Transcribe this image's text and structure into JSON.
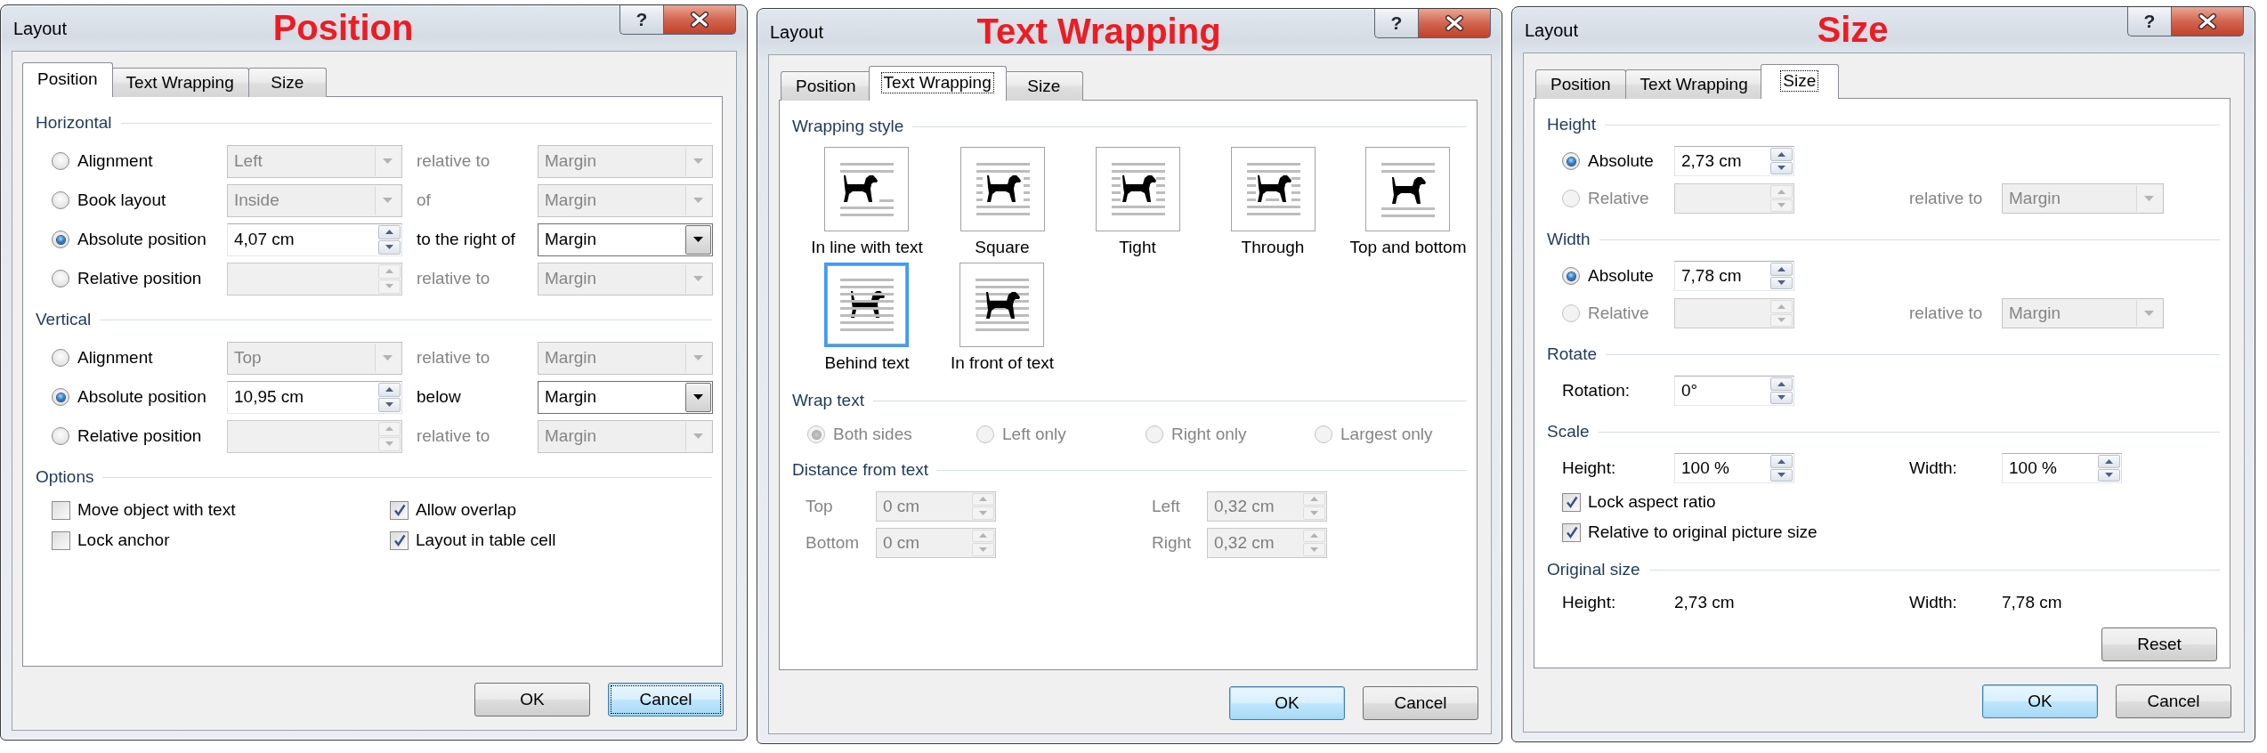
{
  "dialogs": [
    {
      "title": "Layout",
      "annotation": "Position",
      "help": "?",
      "tabs": [
        {
          "label": "Position",
          "selected": true,
          "focused": false
        },
        {
          "label": "Text Wrapping",
          "selected": false,
          "focused": false
        },
        {
          "label": "Size",
          "selected": false,
          "focused": false
        }
      ],
      "sections": [
        {
          "kind": "placement",
          "heading": "Horizontal",
          "rows": [
            [
              {
                "kind": "radio",
                "label": "Alignment",
                "selected": false,
                "disabled": false
              },
              {
                "kind": "dropdown",
                "value": "Left",
                "disabled": true
              },
              {
                "kind": "label",
                "text": "relative to",
                "disabled": true
              },
              {
                "kind": "dropdown",
                "value": "Margin",
                "disabled": true
              }
            ],
            [
              {
                "kind": "radio",
                "label": "Book layout",
                "selected": false,
                "disabled": false
              },
              {
                "kind": "dropdown",
                "value": "Inside",
                "disabled": true
              },
              {
                "kind": "label",
                "text": "of",
                "disabled": true
              },
              {
                "kind": "dropdown",
                "value": "Margin",
                "disabled": true
              }
            ],
            [
              {
                "kind": "radio",
                "label": "Absolute position",
                "selected": true,
                "disabled": false
              },
              {
                "kind": "spin",
                "value": "4,07 cm",
                "disabled": false
              },
              {
                "kind": "label",
                "text": "to the right of",
                "disabled": false
              },
              {
                "kind": "dropdown",
                "value": "Margin",
                "disabled": false
              }
            ],
            [
              {
                "kind": "radio",
                "label": "Relative position",
                "selected": false,
                "disabled": false
              },
              {
                "kind": "spin",
                "disabled": true
              },
              {
                "kind": "label",
                "text": "relative to",
                "disabled": true
              },
              {
                "kind": "dropdown",
                "value": "Margin",
                "disabled": true
              }
            ]
          ]
        },
        {
          "kind": "placement",
          "heading": "Vertical",
          "rows": [
            [
              {
                "kind": "radio",
                "label": "Alignment",
                "selected": false,
                "disabled": false
              },
              {
                "kind": "dropdown",
                "value": "Top",
                "disabled": true
              },
              {
                "kind": "label",
                "text": "relative to",
                "disabled": true
              },
              {
                "kind": "dropdown",
                "value": "Margin",
                "disabled": true
              }
            ],
            [
              {
                "kind": "radio",
                "label": "Absolute position",
                "selected": true,
                "disabled": false
              },
              {
                "kind": "spin",
                "value": "10,95 cm",
                "disabled": false
              },
              {
                "kind": "label",
                "text": "below",
                "disabled": false
              },
              {
                "kind": "dropdown",
                "value": "Margin",
                "disabled": false
              }
            ],
            [
              {
                "kind": "radio",
                "label": "Relative position",
                "selected": false,
                "disabled": false
              },
              {
                "kind": "spin",
                "disabled": true
              },
              {
                "kind": "label",
                "text": "relative to",
                "disabled": true
              },
              {
                "kind": "dropdown",
                "value": "Margin",
                "disabled": true
              }
            ]
          ]
        },
        {
          "kind": "options",
          "heading": "Options",
          "rows": [
            [
              {
                "kind": "check",
                "label": "Move object with text",
                "checked": false
              },
              {
                "kind": "check",
                "label": "Allow overlap",
                "checked": true
              }
            ],
            [
              {
                "kind": "check",
                "label": "Lock anchor",
                "checked": false
              },
              {
                "kind": "check",
                "label": "Layout in table cell",
                "checked": true
              }
            ]
          ]
        }
      ],
      "buttons": [
        {
          "label": "OK",
          "default": false,
          "focused": false
        },
        {
          "label": "Cancel",
          "default": false,
          "focused": true
        }
      ]
    },
    {
      "title": "Layout",
      "annotation": "Text Wrapping",
      "help": "?",
      "tabs": [
        {
          "label": "Position",
          "selected": false,
          "focused": false
        },
        {
          "label": "Text Wrapping",
          "selected": true,
          "focused": true
        },
        {
          "label": "Size",
          "selected": false,
          "focused": false
        }
      ],
      "sections": [
        {
          "kind": "styles",
          "heading": "Wrapping style",
          "styles": [
            {
              "kind": "inline",
              "label": "In line with text",
              "selected": false
            },
            {
              "kind": "square",
              "label": "Square",
              "selected": false
            },
            {
              "kind": "tight",
              "label": "Tight",
              "selected": false
            },
            {
              "kind": "through",
              "label": "Through",
              "selected": false
            },
            {
              "kind": "top_bottom",
              "label": "Top and bottom",
              "selected": false
            },
            {
              "kind": "behind",
              "label": "Behind text",
              "selected": true
            },
            {
              "kind": "front",
              "label": "In front of text",
              "selected": false
            }
          ]
        },
        {
          "kind": "choices",
          "heading": "Wrap text",
          "rows": [
            [
              {
                "kind": "radio",
                "label": "Both sides",
                "selected": true,
                "disabled": true
              },
              {
                "kind": "radio",
                "label": "Left only",
                "selected": false,
                "disabled": true
              },
              {
                "kind": "radio",
                "label": "Right only",
                "selected": false,
                "disabled": true
              },
              {
                "kind": "radio",
                "label": "Largest only",
                "selected": false,
                "disabled": true
              }
            ]
          ]
        },
        {
          "kind": "distance",
          "heading": "Distance from text",
          "rows": [
            [
              {
                "kind": "label",
                "text": "Top",
                "disabled": true
              },
              {
                "kind": "spin",
                "value": "0 cm",
                "disabled": true
              },
              {
                "kind": "label",
                "text": "Left",
                "disabled": true
              },
              {
                "kind": "spin",
                "value": "0,32 cm",
                "disabled": true
              }
            ],
            [
              {
                "kind": "label",
                "text": "Bottom",
                "disabled": true
              },
              {
                "kind": "spin",
                "value": "0 cm",
                "disabled": true
              },
              {
                "kind": "label",
                "text": "Right",
                "disabled": true
              },
              {
                "kind": "spin",
                "value": "0,32 cm",
                "disabled": true
              }
            ]
          ]
        }
      ],
      "buttons": [
        {
          "label": "OK",
          "default": true,
          "focused": false
        },
        {
          "label": "Cancel",
          "default": false,
          "focused": false
        }
      ]
    },
    {
      "title": "Layout",
      "annotation": "Size",
      "help": "?",
      "tabs": [
        {
          "label": "Position",
          "selected": false,
          "focused": false
        },
        {
          "label": "Text Wrapping",
          "selected": false,
          "focused": false
        },
        {
          "label": "Size",
          "selected": true,
          "focused": true
        }
      ],
      "sections": [
        {
          "kind": "dimension",
          "heading": "Height",
          "rows": [
            [
              {
                "kind": "radio",
                "label": "Absolute",
                "selected": true,
                "disabled": false
              },
              {
                "kind": "spin",
                "value": "2,73 cm",
                "disabled": false
              }
            ],
            [
              {
                "kind": "radio",
                "label": "Relative",
                "selected": false,
                "disabled": true
              },
              {
                "kind": "spin",
                "disabled": true
              },
              {
                "kind": "label",
                "text": "relative to",
                "disabled": true
              },
              {
                "kind": "dropdown",
                "value": "Margin",
                "disabled": true
              }
            ]
          ]
        },
        {
          "kind": "dimension",
          "heading": "Width",
          "rows": [
            [
              {
                "kind": "radio",
                "label": "Absolute",
                "selected": true,
                "disabled": false
              },
              {
                "kind": "spin",
                "value": "7,78 cm",
                "disabled": false
              }
            ],
            [
              {
                "kind": "radio",
                "label": "Relative",
                "selected": false,
                "disabled": true
              },
              {
                "kind": "spin",
                "disabled": true
              },
              {
                "kind": "label",
                "text": "relative to",
                "disabled": true
              },
              {
                "kind": "dropdown",
                "value": "Margin",
                "disabled": true
              }
            ]
          ]
        },
        {
          "kind": "dimension",
          "heading": "Rotate",
          "rows": [
            [
              {
                "kind": "label",
                "text": "Rotation:",
                "disabled": false
              },
              {
                "kind": "spin",
                "value": "0°",
                "disabled": false
              }
            ]
          ]
        },
        {
          "kind": "dimension",
          "heading": "Scale",
          "rows": [
            [
              {
                "kind": "label",
                "text": "Height:",
                "disabled": false
              },
              {
                "kind": "spin",
                "value": "100 %",
                "disabled": false
              },
              {
                "kind": "label",
                "text": "Width:",
                "disabled": false
              },
              {
                "kind": "spin",
                "value": "100 %",
                "disabled": false
              }
            ],
            [
              {
                "kind": "check",
                "label": "Lock aspect ratio",
                "checked": true
              }
            ],
            [
              {
                "kind": "check",
                "label": "Relative to original picture size",
                "checked": true
              }
            ]
          ]
        },
        {
          "kind": "dimension",
          "heading": "Original size",
          "rows": [
            [
              {
                "kind": "label",
                "text": "Height:",
                "disabled": false
              },
              {
                "kind": "value",
                "text": "2,73 cm"
              },
              {
                "kind": "label",
                "text": "Width:",
                "disabled": false
              },
              {
                "kind": "value",
                "text": "7,78 cm"
              }
            ],
            [
              {
                "kind": "button",
                "label": "Reset",
                "default": false,
                "focused": false
              }
            ]
          ]
        }
      ],
      "buttons": [
        {
          "label": "OK",
          "default": true,
          "focused": false
        },
        {
          "label": "Cancel",
          "default": false,
          "focused": false
        }
      ]
    }
  ]
}
